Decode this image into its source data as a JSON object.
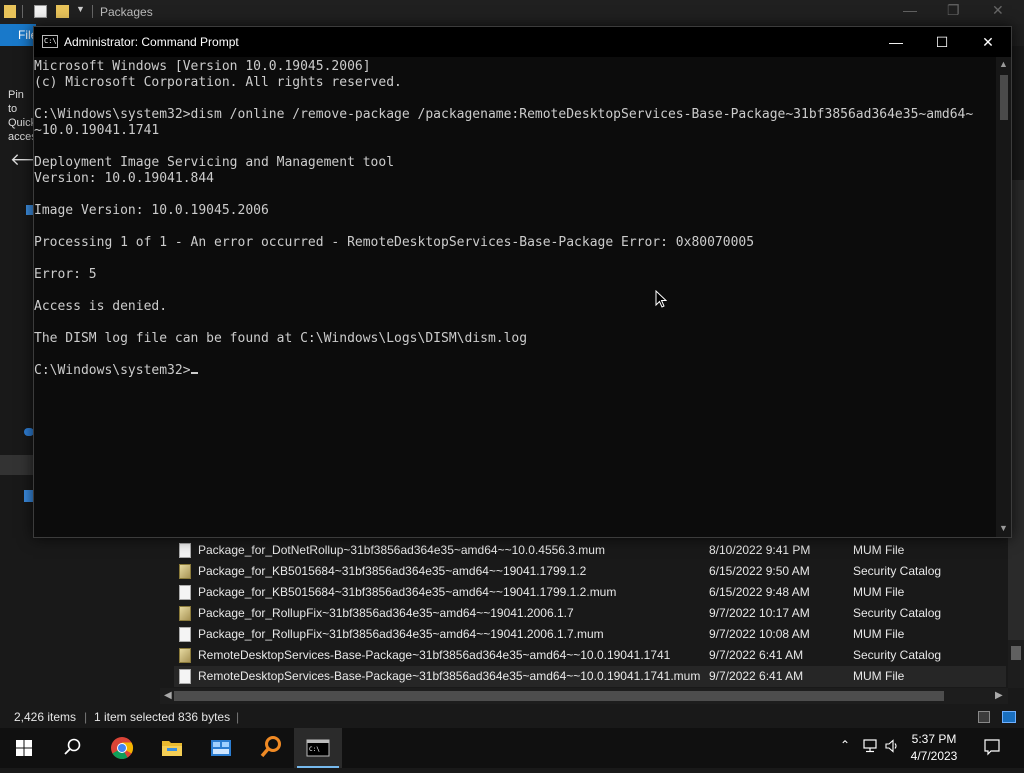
{
  "explorer": {
    "title": "Packages",
    "file_tab_label": "File",
    "pin_text": "Pin to Quick access",
    "files": [
      {
        "name": "Package_for_DotNetRollup~31bf3856ad364e35~amd64~~10.0.4556.3.mum",
        "date": "8/10/2022 9:41 PM",
        "type": "MUM File",
        "icon": "document-icon"
      },
      {
        "name": "Package_for_KB5015684~31bf3856ad364e35~amd64~~19041.1799.1.2",
        "date": "6/15/2022 9:50 AM",
        "type": "Security Catalog",
        "icon": "security-catalog-icon"
      },
      {
        "name": "Package_for_KB5015684~31bf3856ad364e35~amd64~~19041.1799.1.2.mum",
        "date": "6/15/2022 9:48 AM",
        "type": "MUM File",
        "icon": "document-icon"
      },
      {
        "name": "Package_for_RollupFix~31bf3856ad364e35~amd64~~19041.2006.1.7",
        "date": "9/7/2022 10:17 AM",
        "type": "Security Catalog",
        "icon": "security-catalog-icon"
      },
      {
        "name": "Package_for_RollupFix~31bf3856ad364e35~amd64~~19041.2006.1.7.mum",
        "date": "9/7/2022 10:08 AM",
        "type": "MUM File",
        "icon": "document-icon"
      },
      {
        "name": "RemoteDesktopServices-Base-Package~31bf3856ad364e35~amd64~~10.0.19041.1741",
        "date": "9/7/2022 6:41 AM",
        "type": "Security Catalog",
        "icon": "security-catalog-icon"
      },
      {
        "name": "RemoteDesktopServices-Base-Package~31bf3856ad364e35~amd64~~10.0.19041.1741.mum",
        "date": "9/7/2022 6:41 AM",
        "type": "MUM File",
        "icon": "document-icon",
        "selected": true
      }
    ],
    "status": {
      "item_count": "2,426 items",
      "separator": "|",
      "selection": "1 item selected  836 bytes"
    }
  },
  "cmd": {
    "title": "Administrator: Command Prompt",
    "icon_glyph": "C:\\",
    "lines": [
      "Microsoft Windows [Version 10.0.19045.2006]",
      "(c) Microsoft Corporation. All rights reserved.",
      "",
      "C:\\Windows\\system32>dism /online /remove-package /packagename:RemoteDesktopServices-Base-Package~31bf3856ad364e35~amd64~",
      "~10.0.19041.1741",
      "",
      "Deployment Image Servicing and Management tool",
      "Version: 10.0.19041.844",
      "",
      "Image Version: 10.0.19045.2006",
      "",
      "Processing 1 of 1 - An error occurred - RemoteDesktopServices-Base-Package Error: 0x80070005",
      "",
      "Error: 5",
      "",
      "Access is denied.",
      "",
      "The DISM log file can be found at C:\\Windows\\Logs\\DISM\\dism.log",
      "",
      "C:\\Windows\\system32>"
    ],
    "controls": {
      "minimize": "—",
      "maximize": "☐",
      "close": "✕"
    }
  },
  "taskbar": {
    "apps": [
      "start-icon",
      "search-icon",
      "chrome-icon",
      "file-explorer-icon",
      "control-panel-icon",
      "search-everything-icon",
      "command-prompt-icon"
    ],
    "clock": {
      "time": "5:37 PM",
      "date": "4/7/2023"
    }
  },
  "colors": {
    "cmd_background": "#0c0c0c",
    "cmd_text": "#cccccc",
    "taskbar_background": "#101010",
    "accent": "#76b9ed"
  }
}
